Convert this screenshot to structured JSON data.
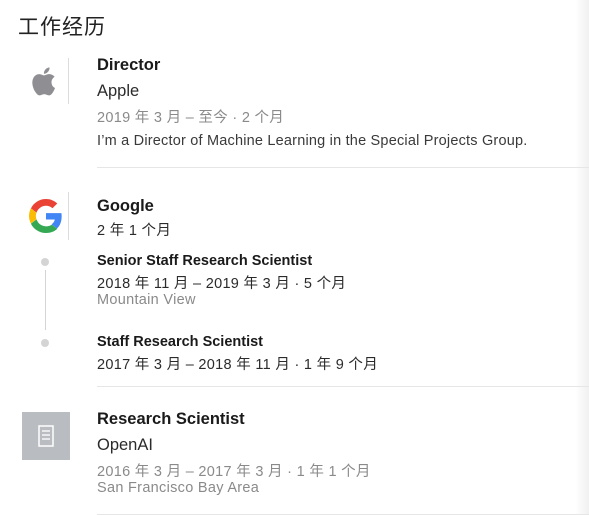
{
  "section": {
    "title": "工作经历"
  },
  "experiences": [
    {
      "title": "Director",
      "company": "Apple",
      "dates": "2019 年 3 月 – 至今 · 2 个月",
      "description": "I’m a Director of Machine Learning in the Special Projects Group.",
      "logo_icon": "apple-logo-icon"
    },
    {
      "company": "Google",
      "total_duration": "2 年 1 个月",
      "logo_icon": "google-logo-icon",
      "roles": [
        {
          "title": "Senior Staff Research Scientist",
          "dates": "2018 年 11 月 – 2019 年 3 月 · 5 个月",
          "location": "Mountain View"
        },
        {
          "title": "Staff Research Scientist",
          "dates": "2017 年 3 月 – 2018 年 11 月 · 1 年 9 个月"
        }
      ]
    },
    {
      "title": "Research Scientist",
      "company": "OpenAI",
      "dates": "2016 年 3 月 – 2017 年 3 月 · 1 年 1 个月",
      "location": "San Francisco Bay Area",
      "logo_icon": "building-placeholder-icon"
    }
  ],
  "colors": {
    "google_blue": "#4285F4",
    "google_red": "#EA4335",
    "google_yellow": "#FBBC05",
    "google_green": "#34A853",
    "apple_gray": "#8e8e93"
  }
}
